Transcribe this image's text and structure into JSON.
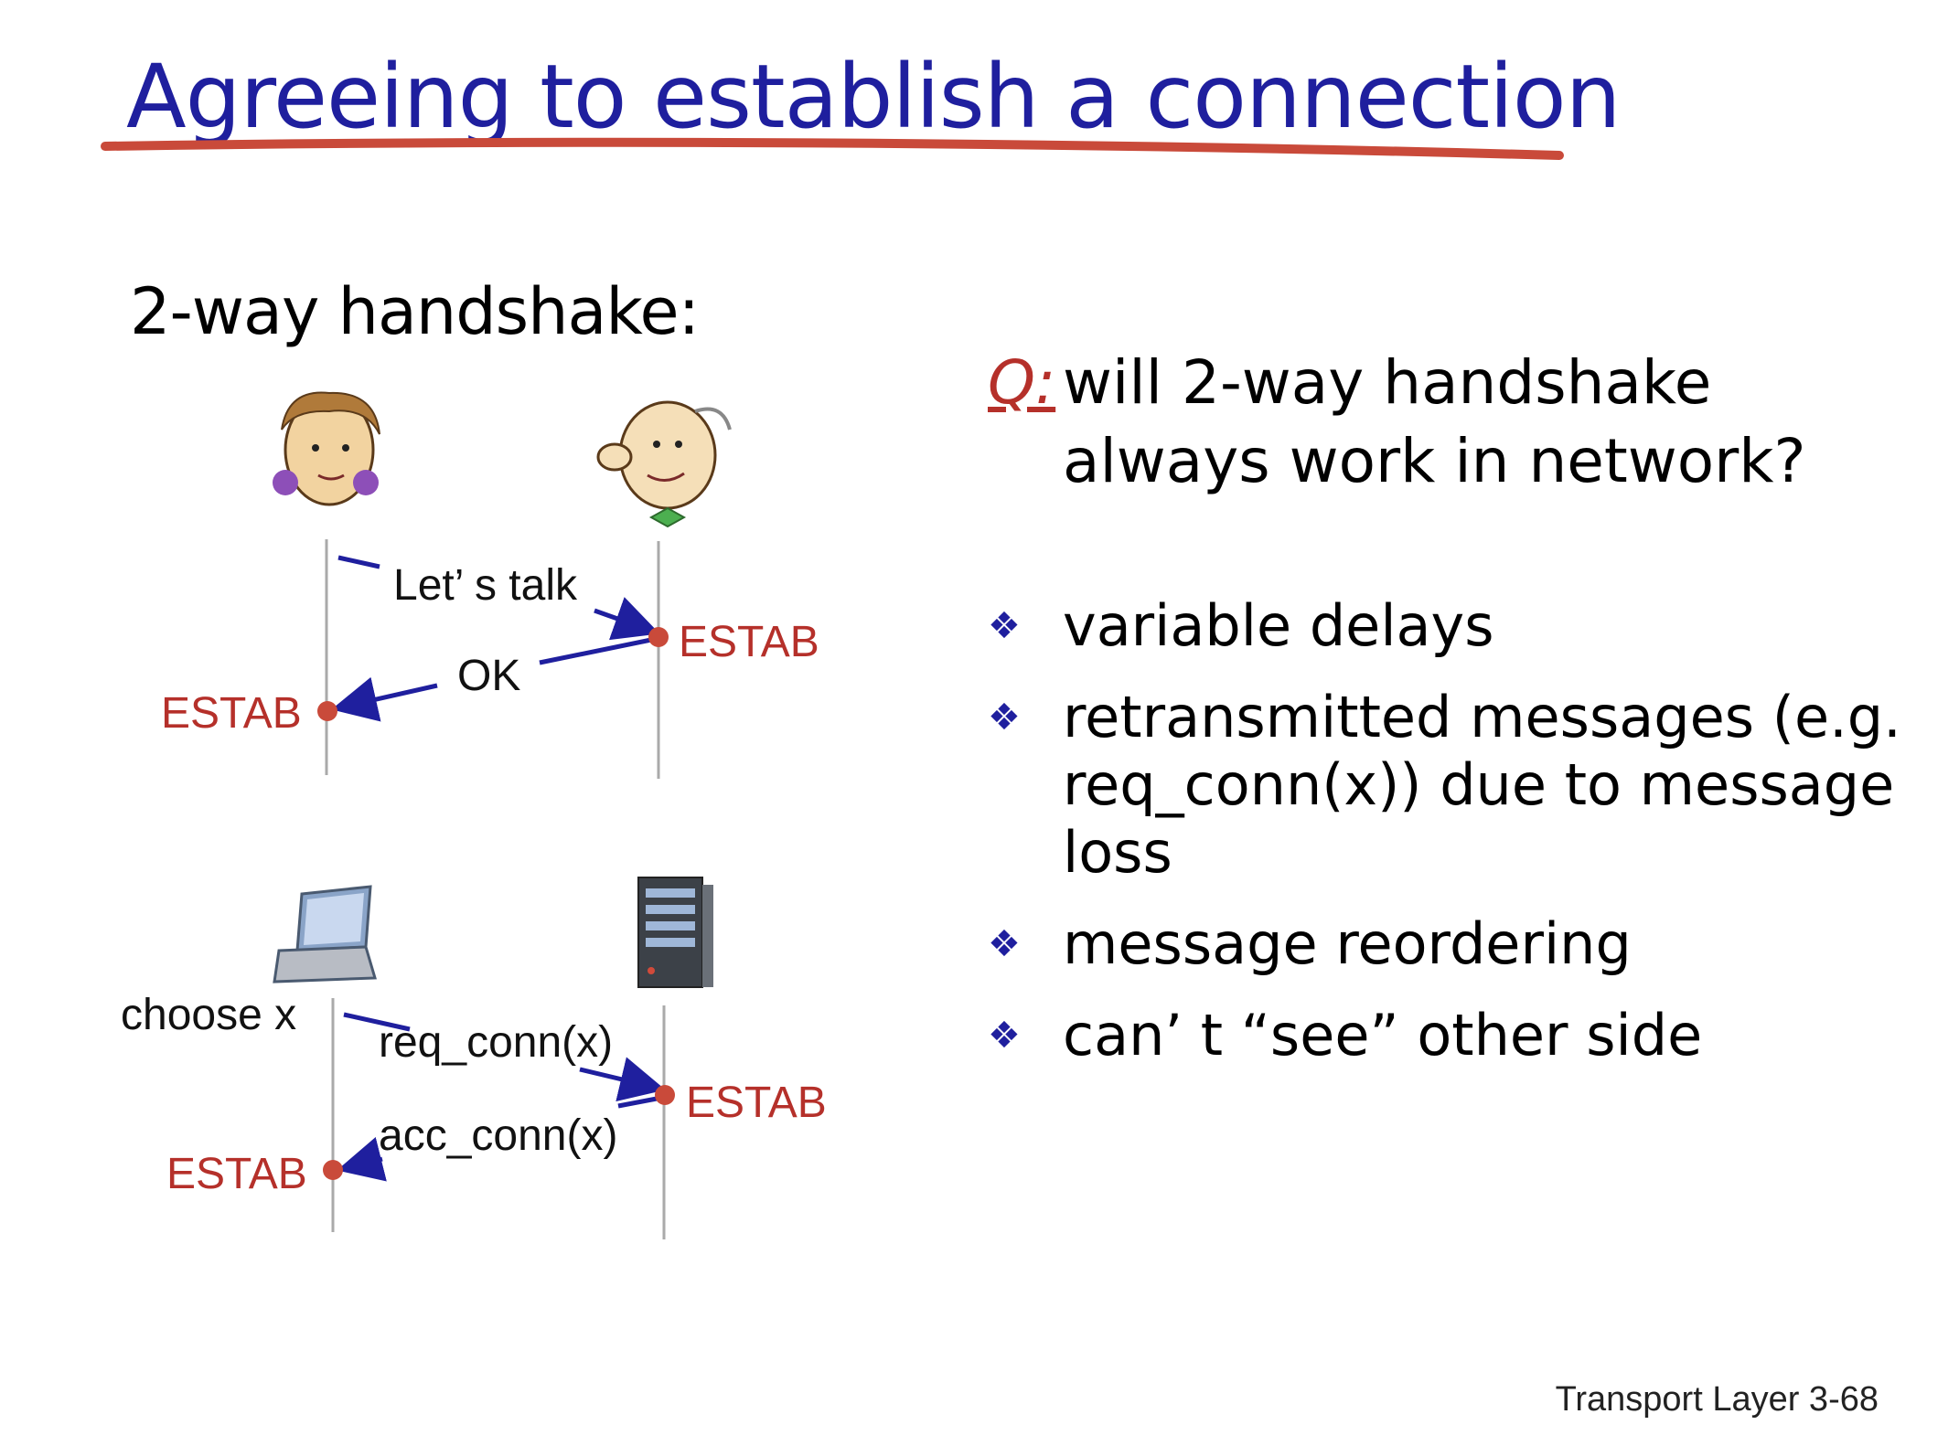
{
  "title": "Agreeing to establish a connection",
  "subtitle": "2-way handshake:",
  "diagram_human": {
    "msg1": "Let’ s talk",
    "msg2": "OK",
    "estab_right": "ESTAB",
    "estab_left": "ESTAB"
  },
  "diagram_machine": {
    "choose": "choose x",
    "msg1": "req_conn(x)",
    "msg2": "acc_conn(x)",
    "estab_right": "ESTAB",
    "estab_left": "ESTAB"
  },
  "question": {
    "label": "Q:",
    "text": "will 2-way handshake always work in network?"
  },
  "bullets": [
    "variable delays",
    "retransmitted messages (e.g. req_conn(x)) due to message loss",
    "message reordering",
    "can’ t “see” other side"
  ],
  "footer": "Transport Layer 3-68",
  "colors": {
    "title": "#1f1f9e",
    "accent_red": "#b5302a",
    "arrow": "#1f1f9e"
  }
}
